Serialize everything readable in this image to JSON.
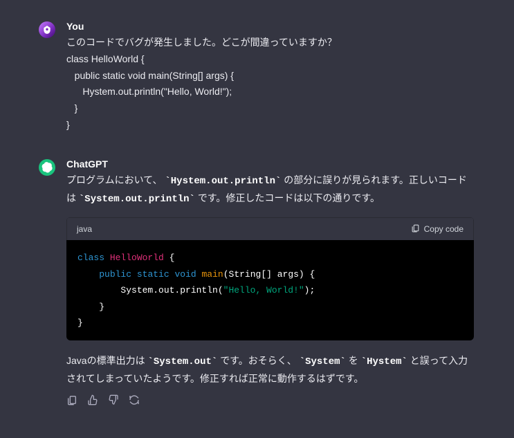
{
  "user": {
    "author": "You",
    "lines": [
      "このコードでバグが発生しました。どこが間違っていますか？",
      "class HelloWorld {",
      "   public static void main(String[] args) {",
      "      Hystem.out.println(\"Hello, World!\");",
      "   }",
      "}"
    ]
  },
  "assistant": {
    "author": "ChatGPT",
    "para1": {
      "t0": "プログラムにおいて、",
      "c0": "`Hystem.out.println`",
      "t1": " の部分に誤りが見られます。正しいコードは ",
      "c1": "`System.out.println`",
      "t2": " です。修正したコードは以下の通りです。"
    },
    "code": {
      "lang": "java",
      "copy": "Copy code",
      "kw_class": "class",
      "cls_name": "HelloWorld",
      "brace_o": " {",
      "kw_public": "public",
      "kw_static": "static",
      "kw_void": "void",
      "fn_main": "main",
      "args": "(String[] args) {",
      "print_pre": "        System.out.println(",
      "str": "\"Hello, World!\"",
      "print_post": ");",
      "close1": "    }",
      "close0": "}"
    },
    "para2": {
      "t0": "Javaの標準出力は ",
      "c0": "`System.out`",
      "t1": " です。おそらく、",
      "c1": "`System`",
      "t2": " を ",
      "c2": "`Hystem`",
      "t3": " と誤って入力されてしまっていたようです。修正すれば正常に動作するはずです。"
    }
  }
}
